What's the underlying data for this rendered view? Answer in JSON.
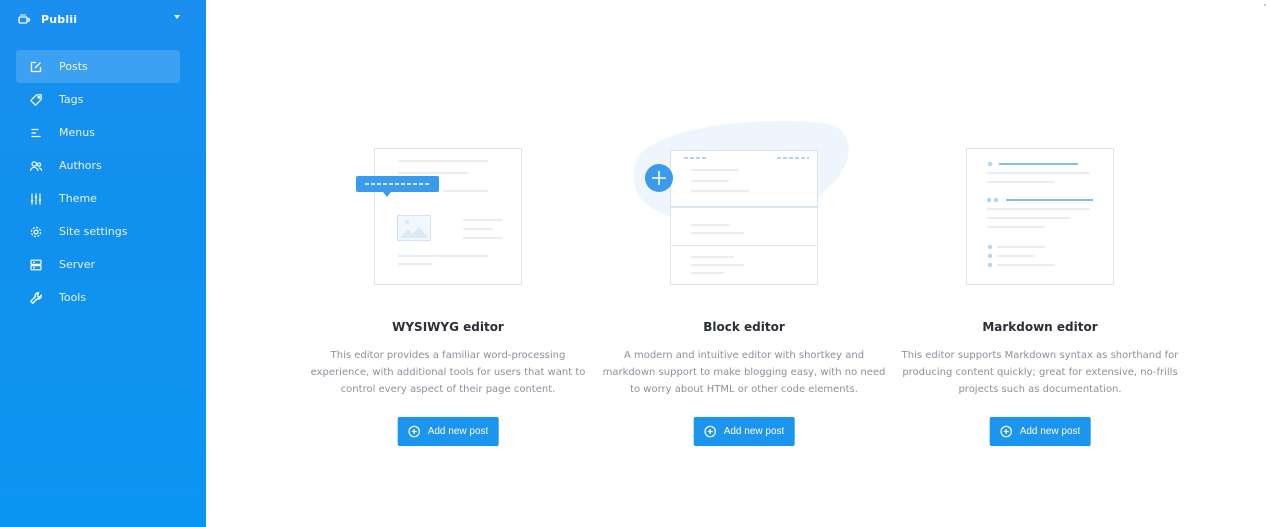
{
  "sidebar": {
    "site_name": "Publii",
    "items": [
      {
        "label": "Posts",
        "icon": "posts-icon",
        "active": true
      },
      {
        "label": "Tags",
        "icon": "tag-icon",
        "active": false
      },
      {
        "label": "Menus",
        "icon": "menu-icon",
        "active": false
      },
      {
        "label": "Authors",
        "icon": "authors-icon",
        "active": false
      },
      {
        "label": "Theme",
        "icon": "sliders-icon",
        "active": false
      },
      {
        "label": "Site settings",
        "icon": "gear-icon",
        "active": false
      },
      {
        "label": "Server",
        "icon": "server-icon",
        "active": false
      },
      {
        "label": "Tools",
        "icon": "wrench-icon",
        "active": false
      }
    ]
  },
  "editors": [
    {
      "title": "WYSIWYG editor",
      "description": "This editor provides a familiar word-processing experience, with additional tools for users that want to control every aspect of their page content.",
      "button_label": "Add new post"
    },
    {
      "title": "Block editor",
      "description": "A modern and intuitive editor with shortkey and markdown support to make blogging easy, with no need to worry about HTML or other code elements.",
      "button_label": "Add new post"
    },
    {
      "title": "Markdown editor",
      "description": "This editor supports Markdown syntax as shorthand for producing content quickly; great for extensive, no-frills projects such as documentation.",
      "button_label": "Add new post"
    }
  ],
  "colors": {
    "sidebar_blue": "#1a8ff0",
    "accent": "#1c95ef",
    "title_text": "#2b2f36",
    "body_text": "#8a929c"
  }
}
